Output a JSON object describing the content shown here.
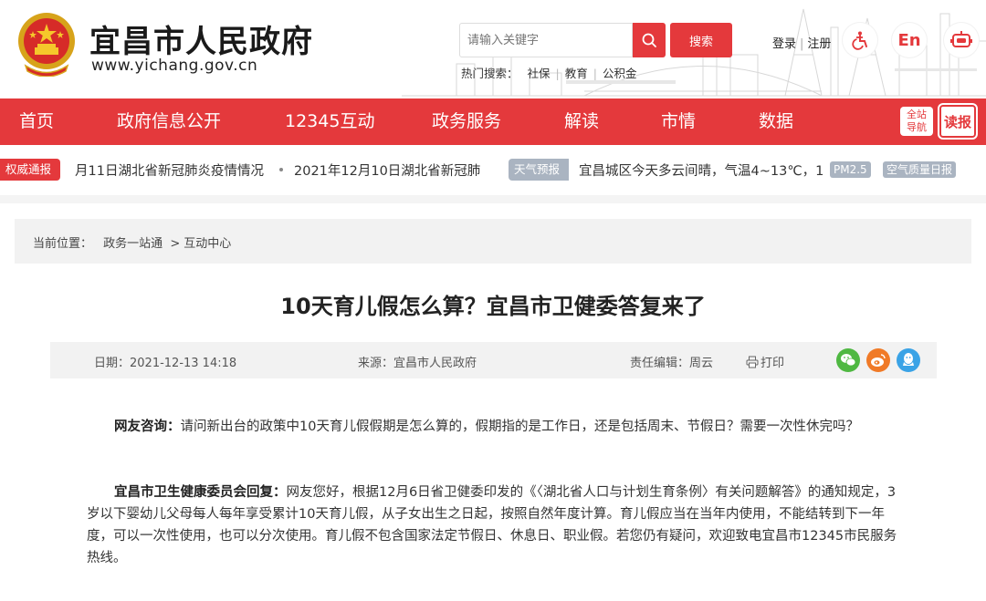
{
  "header": {
    "site_title": "宜昌市人民政府",
    "site_url": "www.yichang.gov.cn",
    "search_placeholder": "请输入关键字",
    "search_button": "搜索",
    "hot_search_label": "热门搜索：",
    "hot_search_items": [
      "社保",
      "教育",
      "公积金"
    ],
    "login": "登录",
    "register": "注册",
    "english": "En",
    "icons": [
      "emblem-icon",
      "search-icon",
      "accessibility-icon",
      "robot-icon"
    ]
  },
  "nav": {
    "items": [
      "首页",
      "政府信息公开",
      "12345互动",
      "政务服务",
      "解读",
      "市情",
      "数据"
    ],
    "guide_badge": [
      "全站",
      "导航"
    ],
    "read_badge": "读报"
  },
  "ticker": {
    "auth_tag": "权威通报",
    "auth_item_1": "月11日湖北省新冠肺炎疫情情况",
    "auth_item_2": "2021年12月10日湖北省新冠肺",
    "weather_tag": "天气预报",
    "weather_text": "宜昌城区今天多云间晴，气温4~13℃，1",
    "pm_badge": "PM2.5",
    "air_badge": "空气质量日报"
  },
  "content": {
    "breadcrumb_label": "当前位置：",
    "breadcrumb_1": "政务一站通",
    "breadcrumb_sep": ">",
    "breadcrumb_2": "互动中心",
    "title": "10天育儿假怎么算？宜昌市卫健委答复来了",
    "date": "日期：2021-12-13 14:18",
    "source": "来源：宜昌市人民政府",
    "editor": "责任编辑：周云",
    "print": "打印",
    "q_label": "网友咨询：",
    "q_text": "请问新出台的政策中10天育儿假假期是怎么算的，假期指的是工作日，还是包括周末、节假日？需要一次性休完吗？",
    "a_label": "宜昌市卫生健康委员会回复：",
    "a_text": "网友您好，根据12月6日省卫健委印发的《〈湖北省人口与计划生育条例〉有关问题解答》的通知规定，3岁以下婴幼儿父母每人每年享受累计10天育儿假，从子女出生之日起，按照自然年度计算。育儿假应当在当年内使用，不能结转到下一年度，可以一次性使用，也可以分次使用。育儿假不包含国家法定节假日、休息日、职业假。若您仍有疑问，欢迎致电宜昌市12345市民服务热线。"
  },
  "colors": {
    "brand_red": "#e4393c",
    "badge_gray": "#aab4c1",
    "wechat": "#4fb842",
    "weibo": "#f07a27",
    "qq": "#3aa3e6"
  }
}
